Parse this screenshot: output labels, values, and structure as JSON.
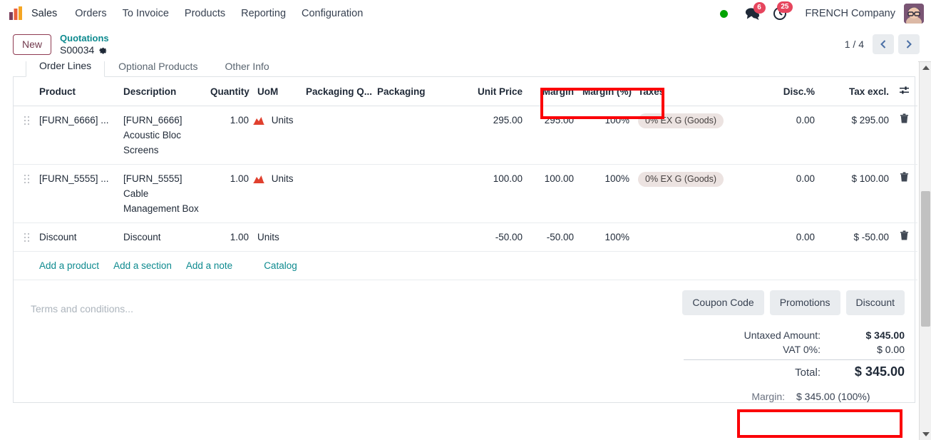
{
  "navbar": {
    "logo_icon": "odoo-sales-logo-icon",
    "app_name": "Sales",
    "menu": [
      {
        "label": "Orders"
      },
      {
        "label": "To Invoice"
      },
      {
        "label": "Products"
      },
      {
        "label": "Reporting"
      },
      {
        "label": "Configuration"
      }
    ],
    "status_dot_color": "#00a300",
    "messages_icon": "chat-bubble-icon",
    "messages_count": "6",
    "activities_icon": "clock-activity-icon",
    "activities_count": "25",
    "company": "FRENCH Company",
    "avatar_icon": "user-avatar-icon"
  },
  "control_panel": {
    "new_label": "New",
    "breadcrumb_parent": "Quotations",
    "breadcrumb_current": "S00034",
    "settings_icon": "gear-icon",
    "pager_count": "1 / 4",
    "prev_icon": "chevron-left-icon",
    "next_icon": "chevron-right-icon"
  },
  "notebook": {
    "tabs": [
      {
        "label": "Order Lines",
        "active": true
      },
      {
        "label": "Optional Products",
        "active": false
      },
      {
        "label": "Other Info",
        "active": false
      }
    ]
  },
  "order_lines": {
    "columns": [
      "Product",
      "Description",
      "Quantity",
      "UoM",
      "Packaging Q...",
      "Packaging",
      "Unit Price",
      "Margin",
      "Margin (%)",
      "Taxes",
      "Disc.%",
      "Tax excl."
    ],
    "optional_columns_icon": "column-options-icon",
    "drag_handle_icon": "drag-handle-icon",
    "forecast_icon": "forecast-report-icon",
    "delete_icon": "trash-icon",
    "rows": [
      {
        "product": "[FURN_6666] ...",
        "description": "[FURN_6666] Acoustic Bloc Screens",
        "quantity": "1.00",
        "has_forecast": true,
        "uom": "Units",
        "packaging_qty": "",
        "packaging": "",
        "unit_price": "295.00",
        "margin": "295.00",
        "margin_pct": "100%",
        "taxes": "0% EX G (Goods)",
        "disc": "0.00",
        "tax_excl": "$ 295.00"
      },
      {
        "product": "[FURN_5555] ...",
        "description": "[FURN_5555] Cable Management Box",
        "quantity": "1.00",
        "has_forecast": true,
        "uom": "Units",
        "packaging_qty": "",
        "packaging": "",
        "unit_price": "100.00",
        "margin": "100.00",
        "margin_pct": "100%",
        "taxes": "0% EX G (Goods)",
        "disc": "0.00",
        "tax_excl": "$ 100.00"
      },
      {
        "product": "Discount",
        "description": "Discount",
        "quantity": "1.00",
        "has_forecast": false,
        "uom": "Units",
        "packaging_qty": "",
        "packaging": "",
        "unit_price": "-50.00",
        "margin": "-50.00",
        "margin_pct": "100%",
        "taxes": "",
        "disc": "0.00",
        "tax_excl": "$ -50.00"
      }
    ],
    "add_links": [
      {
        "label": "Add a product"
      },
      {
        "label": "Add a section"
      },
      {
        "label": "Add a note"
      },
      {
        "label": "Catalog"
      }
    ]
  },
  "footer": {
    "terms_placeholder": "Terms and conditions...",
    "promo_buttons": [
      {
        "label": "Coupon Code"
      },
      {
        "label": "Promotions"
      },
      {
        "label": "Discount"
      }
    ],
    "totals": [
      {
        "label": "Untaxed Amount:",
        "value": "$ 345.00"
      },
      {
        "label": "VAT 0%:",
        "value": "$ 0.00"
      },
      {
        "label": "Total:",
        "value": "$ 345.00"
      }
    ],
    "margin_label": "Margin:",
    "margin_value": "$ 345.00 (100%)"
  },
  "annotations": {
    "highlight_color": "#fb0007",
    "boxes": [
      {
        "name": "margin-columns-header-highlight"
      },
      {
        "name": "margin-total-highlight"
      }
    ]
  },
  "scrollbar": {
    "up_icon": "scroll-up-arrow-icon",
    "down_icon": "scroll-down-arrow-icon"
  }
}
